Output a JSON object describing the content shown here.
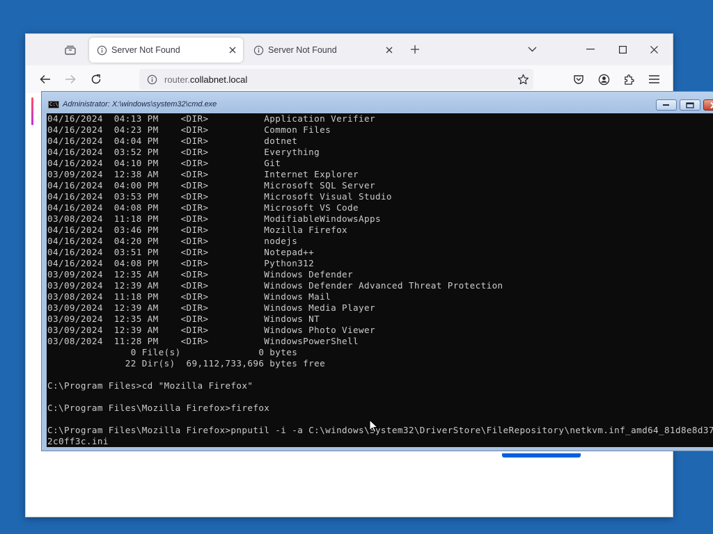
{
  "browser": {
    "tabs": [
      {
        "title": "Server Not Found",
        "active": true
      },
      {
        "title": "Server Not Found",
        "active": false
      }
    ],
    "url": {
      "prefix": "router.",
      "host": "collabnet.local"
    },
    "accent_color": "#0061e0"
  },
  "cmd": {
    "title": "Administrator: X:\\windows\\system32\\cmd.exe",
    "icon_text": "C:\\",
    "lines": [
      "04/16/2024  04:13 PM    <DIR>          Application Verifier",
      "04/16/2024  04:23 PM    <DIR>          Common Files",
      "04/16/2024  04:04 PM    <DIR>          dotnet",
      "04/16/2024  03:52 PM    <DIR>          Everything",
      "04/16/2024  04:10 PM    <DIR>          Git",
      "03/09/2024  12:38 AM    <DIR>          Internet Explorer",
      "04/16/2024  04:00 PM    <DIR>          Microsoft SQL Server",
      "04/16/2024  03:53 PM    <DIR>          Microsoft Visual Studio",
      "04/16/2024  04:08 PM    <DIR>          Microsoft VS Code",
      "03/08/2024  11:18 PM    <DIR>          ModifiableWindowsApps",
      "04/16/2024  03:46 PM    <DIR>          Mozilla Firefox",
      "04/16/2024  04:20 PM    <DIR>          nodejs",
      "04/16/2024  03:51 PM    <DIR>          Notepad++",
      "04/16/2024  04:08 PM    <DIR>          Python312",
      "03/09/2024  12:35 AM    <DIR>          Windows Defender",
      "03/09/2024  12:39 AM    <DIR>          Windows Defender Advanced Threat Protection",
      "03/08/2024  11:18 PM    <DIR>          Windows Mail",
      "03/09/2024  12:39 AM    <DIR>          Windows Media Player",
      "03/09/2024  12:35 AM    <DIR>          Windows NT",
      "03/09/2024  12:39 AM    <DIR>          Windows Photo Viewer",
      "03/08/2024  11:28 PM    <DIR>          WindowsPowerShell",
      "               0 File(s)              0 bytes",
      "              22 Dir(s)  69,112,733,696 bytes free",
      "",
      "C:\\Program Files>cd \"Mozilla Firefox\"",
      "",
      "C:\\Program Files\\Mozilla Firefox>firefox",
      "",
      "C:\\Program Files\\Mozilla Firefox>pnputil -i -a C:\\windows\\System32\\DriverStore\\FileRepository\\netkvm.inf_amd64_81d8e8d37",
      "2c0ff3c.ini"
    ]
  }
}
